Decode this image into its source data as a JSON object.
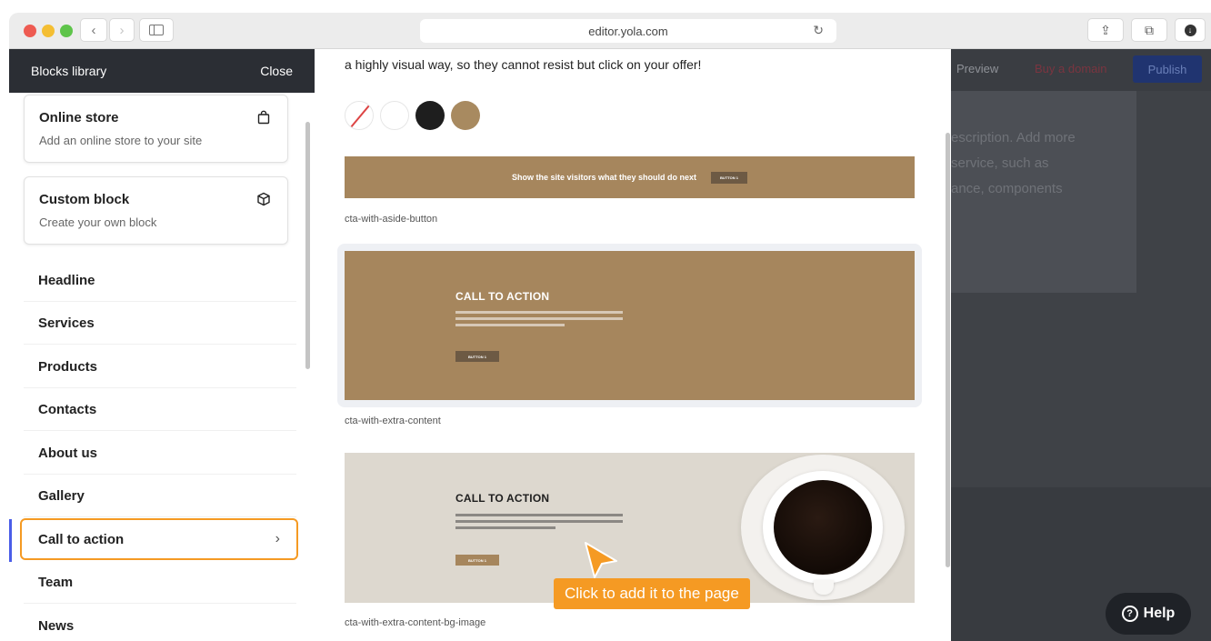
{
  "browser": {
    "url": "editor.yola.com",
    "back_glyph": "‹",
    "forward_glyph": "›",
    "reload_glyph": "↻",
    "share_glyph": "⇪",
    "tabs_glyph": "⧉",
    "download_glyph": "↓"
  },
  "library": {
    "title": "Blocks library",
    "close_label": "Close",
    "cards": [
      {
        "title": "Online store",
        "description": "Add an online store to your site",
        "icon": "shopping-bag-icon"
      },
      {
        "title": "Custom block",
        "description": "Create your own block",
        "icon": "cube-icon"
      }
    ],
    "categories": [
      {
        "label": "Headline"
      },
      {
        "label": "Services"
      },
      {
        "label": "Products"
      },
      {
        "label": "Contacts"
      },
      {
        "label": "About us"
      },
      {
        "label": "Gallery"
      },
      {
        "label": "Call to action",
        "selected": true
      },
      {
        "label": "Team"
      },
      {
        "label": "News"
      }
    ],
    "chevron": "›"
  },
  "preview": {
    "intro_text": "a highly visual way, so they cannot resist but click on your offer!",
    "swatches": [
      "none",
      "#ffffff",
      "#1e1e1e",
      "#a88a60"
    ],
    "templates": [
      {
        "name": "cta-with-aside-button",
        "text": "Show the site visitors what they should do next",
        "button": "BUTTON 1"
      },
      {
        "name": "cta-with-extra-content",
        "title": "CALL TO ACTION",
        "button": "BUTTON 1"
      },
      {
        "name": "cta-with-extra-content-bg-image",
        "title": "CALL TO ACTION",
        "button": "BUTTON 1"
      }
    ],
    "tooltip": "Click to add it to the page"
  },
  "editor_behind": {
    "preview_label": "Preview",
    "buy_domain_label": "Buy a domain",
    "publish_label": "Publish",
    "body_lines": [
      "escription. Add more",
      "service, such as",
      "ance, components"
    ]
  },
  "help": {
    "label": "Help",
    "glyph": "?"
  },
  "colors": {
    "accent_orange": "#f59a23",
    "selection_blue": "#4a5de8",
    "header_dark": "#2b2e34",
    "thumbnail_brown": "#a6865d"
  }
}
